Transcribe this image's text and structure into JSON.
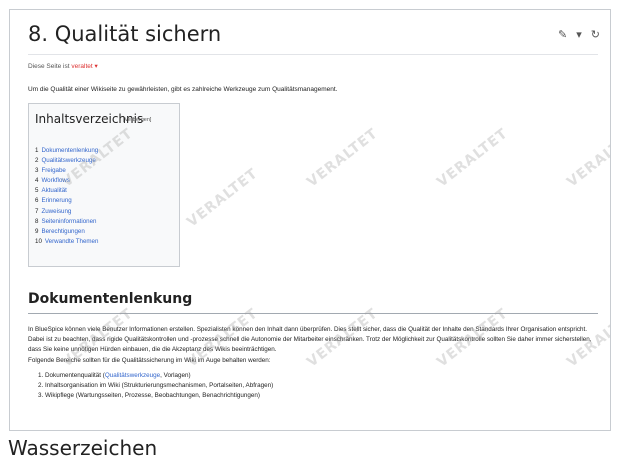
{
  "page": {
    "title": "8. Qualität sichern",
    "status_prefix": "Diese Seite ist ",
    "status_value": "veraltet ▾",
    "intro": "Um die Qualität einer Wikiseite zu gewährleisten, gibt es zahlreiche Werkzeuge zum Qualitätsmanagement."
  },
  "tools": {
    "edit": "✎",
    "dropdown": "▾",
    "refresh": "↻"
  },
  "toc": {
    "title": "Inhaltsverzeichnis",
    "toggle": "[Verbergen]",
    "items": [
      {
        "num": "1",
        "label": "Dokumentenlenkung"
      },
      {
        "num": "2",
        "label": "Qualitätswerkzeuge"
      },
      {
        "num": "3",
        "label": "Freigabe"
      },
      {
        "num": "4",
        "label": "Workflows"
      },
      {
        "num": "5",
        "label": "Aktualität"
      },
      {
        "num": "6",
        "label": "Erinnerung"
      },
      {
        "num": "7",
        "label": "Zuweisung"
      },
      {
        "num": "8",
        "label": "Seiteninformationen"
      },
      {
        "num": "9",
        "label": "Berechtigungen"
      },
      {
        "num": "10",
        "label": "Verwandte Themen"
      }
    ]
  },
  "section": {
    "title": "Dokumentenlenkung",
    "paragraph": "In BlueSpice können viele Benutzer Informationen erstellen. Spezialisten können den Inhalt dann überprüfen. Dies stellt sicher, dass die Qualität der Inhalte den Standards Ihrer Organisation entspricht. Dabei ist zu beachten, dass rigide Qualitätskontrollen und -prozesse schnell die Autonomie der Mitarbeiter einschränken. Trotz der Möglichkeit zur Qualitätskontrolle sollten Sie daher immer sicherstellen, dass Sie keine unnötigen Hürden einbauen, die die Akzeptanz des Wikis beeinträchtigen.",
    "lead": "Folgende Bereiche sollten für die Qualitätssicherung im Wiki im Auge behalten werden:",
    "list": [
      {
        "prefix": "1. Dokumentenqualität (",
        "link": "Qualitätswerkzeuge",
        "suffix": ", Vorlagen)"
      },
      {
        "prefix": "2. Inhaltsorganisation im Wiki (Strukturierungsmechanismen, Portalseiten, Abfragen)",
        "link": "",
        "suffix": ""
      },
      {
        "prefix": "3. Wikipflege (Wartungsseiten, Prozesse, Beobachtungen, Benachrichtigungen)",
        "link": "",
        "suffix": ""
      }
    ]
  },
  "watermark": "VERALTET",
  "caption": "Wasserzeichen"
}
